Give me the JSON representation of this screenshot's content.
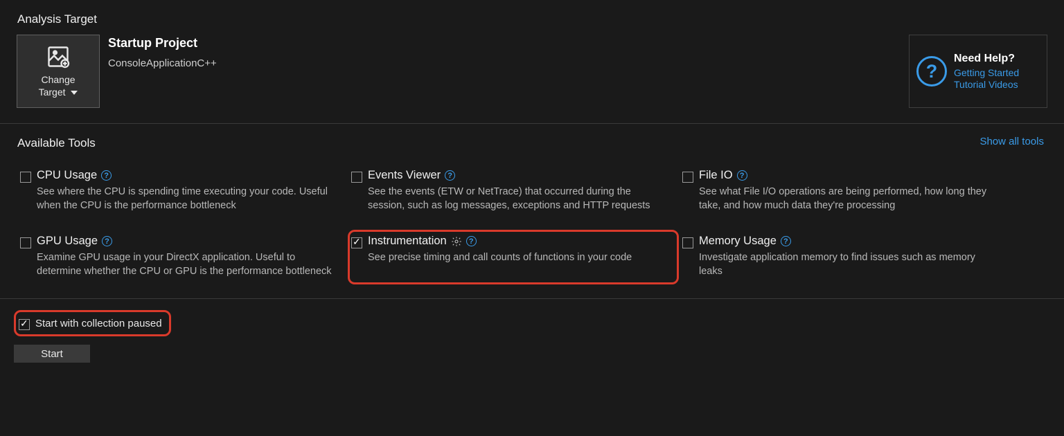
{
  "header": {
    "analysis_target": "Analysis Target",
    "change_target_line1": "Change",
    "change_target_line2": "Target",
    "startup_title": "Startup Project",
    "startup_sub": "ConsoleApplicationC++",
    "help": {
      "title": "Need Help?",
      "link1": "Getting Started",
      "link2": "Tutorial Videos"
    }
  },
  "tools_section": {
    "title": "Available Tools",
    "show_all": "Show all tools"
  },
  "tools": {
    "cpu": {
      "title": "CPU Usage",
      "desc": "See where the CPU is spending time executing your code. Useful when the CPU is the performance bottleneck",
      "checked": false
    },
    "events": {
      "title": "Events Viewer",
      "desc": "See the events (ETW or NetTrace) that occurred during the session, such as log messages, exceptions and HTTP requests",
      "checked": false
    },
    "fileio": {
      "title": "File IO",
      "desc": "See what File I/O operations are being performed, how long they take, and how much data they're processing",
      "checked": false
    },
    "gpu": {
      "title": "GPU Usage",
      "desc": "Examine GPU usage in your DirectX application. Useful to determine whether the CPU or GPU is the performance bottleneck",
      "checked": false
    },
    "instr": {
      "title": "Instrumentation",
      "desc": "See precise timing and call counts of functions in your code",
      "checked": true
    },
    "mem": {
      "title": "Memory Usage",
      "desc": "Investigate application memory to find issues such as memory leaks",
      "checked": false
    }
  },
  "footer": {
    "start_paused_label": "Start with collection paused",
    "start_paused_checked": true,
    "start_button": "Start"
  },
  "colors": {
    "accent": "#3a9be8",
    "highlight": "#d93a2b",
    "bg": "#1a1a1a"
  }
}
